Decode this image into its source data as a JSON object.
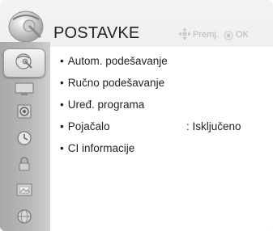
{
  "header": {
    "title": "POSTAVKE",
    "hint_move_label": "Premj.",
    "hint_ok_label": "OK",
    "top_icon": "satellite-dish-icon"
  },
  "sidebar": {
    "tabs": [
      {
        "icon": "satellite-dish-icon",
        "active": true
      },
      {
        "icon": "tv-screen-icon",
        "active": false
      },
      {
        "icon": "speaker-icon",
        "active": false
      },
      {
        "icon": "clock-icon",
        "active": false
      },
      {
        "icon": "lock-icon",
        "active": false
      },
      {
        "icon": "picture-frame-icon",
        "active": false
      },
      {
        "icon": "globe-icon",
        "active": false
      }
    ]
  },
  "menu": {
    "bullet": "•",
    "items": [
      {
        "label": "Autom. podešavanje",
        "value": ""
      },
      {
        "label": "Ručno podešavanje",
        "value": ""
      },
      {
        "label": "Uređ. programa",
        "value": ""
      },
      {
        "label": "Pojačalo",
        "value": ": Isključeno"
      },
      {
        "label": "CI informacije",
        "value": ""
      }
    ]
  },
  "colors": {
    "sidebar": "#b4b4b4",
    "content_bg": "#ffffff",
    "text": "#1f1f1f",
    "hint_text": "#b7b7b7"
  }
}
